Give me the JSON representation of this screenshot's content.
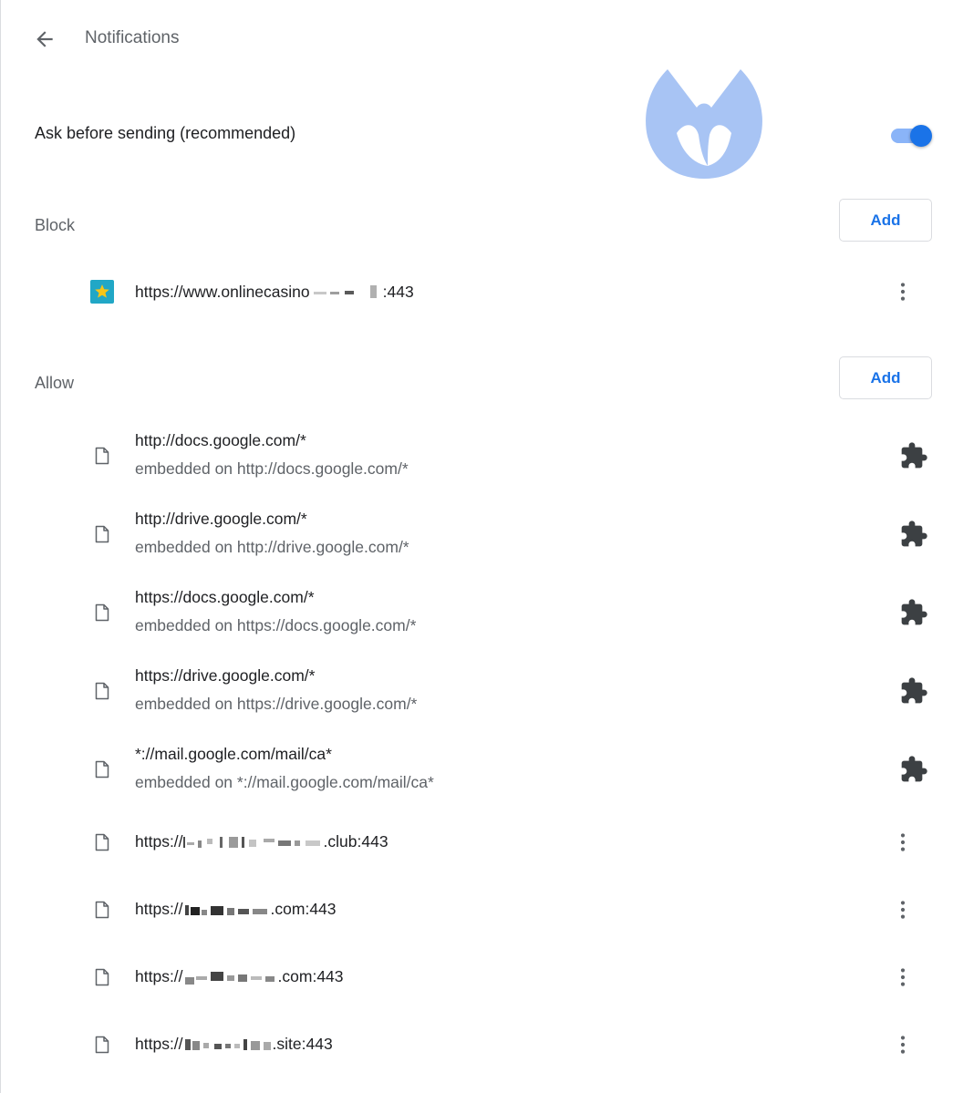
{
  "header": {
    "title": "Notifications"
  },
  "ask": {
    "label": "Ask before sending (recommended)",
    "enabled": true
  },
  "block": {
    "label": "Block",
    "add_label": "Add",
    "sites": [
      {
        "url": "https://www.onlinecasino",
        "url_suffix": ":443",
        "icon": "star-favicon-icon"
      }
    ]
  },
  "allow": {
    "label": "Allow",
    "add_label": "Add",
    "sites": [
      {
        "url": "http://docs.google.com/*",
        "sub": "embedded on http://docs.google.com/*",
        "action_icon": "extension-icon"
      },
      {
        "url": "http://drive.google.com/*",
        "sub": "embedded on http://drive.google.com/*",
        "action_icon": "extension-icon"
      },
      {
        "url": "https://docs.google.com/*",
        "sub": "embedded on https://docs.google.com/*",
        "action_icon": "extension-icon"
      },
      {
        "url": "https://drive.google.com/*",
        "sub": "embedded on https://drive.google.com/*",
        "action_icon": "extension-icon"
      },
      {
        "url": "*://mail.google.com/mail/ca*",
        "sub": "embedded on *://mail.google.com/mail/ca*",
        "action_icon": "extension-icon"
      },
      {
        "url_prefix": "https://",
        "url_suffix": ".club:443",
        "action_icon": "more-vert-icon"
      },
      {
        "url_prefix": "https://",
        "url_suffix": ".com:443",
        "action_icon": "more-vert-icon"
      },
      {
        "url_prefix": "https://",
        "url_suffix": ".com:443",
        "action_icon": "more-vert-icon"
      },
      {
        "url_prefix": "https://",
        "url_suffix": ".site:443",
        "action_icon": "more-vert-icon"
      }
    ]
  },
  "colors": {
    "accent": "#1a73e8",
    "toggle_track": "#8ab4f8",
    "watermark": "#a8c4f4",
    "muted_text": "#5f6368"
  }
}
